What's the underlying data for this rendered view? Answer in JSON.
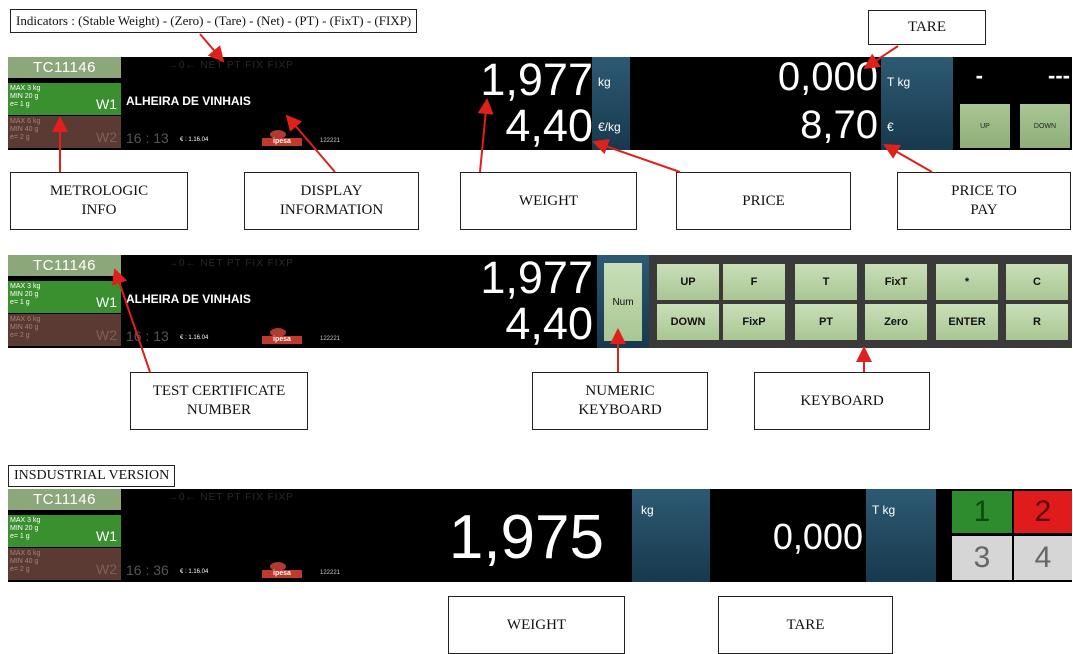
{
  "indicators_box": "Indicators : (Stable Weight) - (Zero) - (Tare) - (Net) - (PT) - (FixT) - (FIXP)",
  "industrial_box": "INSDUSTRIAL VERSION",
  "display": {
    "cert": "TC11146",
    "w1_lines": [
      "MAX  3 kg",
      "MIN  20 g",
      "e=    1 g"
    ],
    "w2_lines": [
      "MAX  6 kg",
      "MIN  40 g",
      "e=    2 g"
    ],
    "w1": "W1",
    "w2": "W2",
    "indicators": "→0←  NET   PT   FIX    FIXP",
    "product": "ALHEIRA DE VINHAIS",
    "euro_small": "€ : 1.16.04",
    "logo_text": "ipesa",
    "code": "122221"
  },
  "panel1": {
    "time": "16 : 13",
    "weight": "1,977",
    "price": "4,40",
    "unit_weight": "kg",
    "unit_price": "€/kg",
    "tare": "0,000",
    "topay": "8,70",
    "unit_tare": "T kg",
    "unit_topay": "€",
    "dash1": "-",
    "dash2": "---",
    "btn_up": "UP",
    "btn_down": "DOWN"
  },
  "panel2": {
    "time": "16 : 13",
    "weight": "1,977",
    "price": "4,40",
    "num": "Num",
    "keys_top": [
      "UP",
      "F",
      "T",
      "FixT",
      "*",
      "C"
    ],
    "keys_bottom": [
      "DOWN",
      "FixP",
      "PT",
      "Zero",
      "ENTER",
      "R"
    ]
  },
  "panel3": {
    "time": "16 : 36",
    "weight": "1,975",
    "unit_weight": "kg",
    "tare": "0,000",
    "unit_tare": "T kg",
    "quad": [
      "1",
      "2",
      "3",
      "4"
    ]
  },
  "callouts": {
    "tare": "TARE",
    "metrologic": "METROLOGIC\nINFO",
    "display_info": "DISPLAY\nINFORMATION",
    "weight": "WEIGHT",
    "price": "PRICE",
    "price_to_pay": "PRICE TO\nPAY",
    "test_cert": "TEST CERTIFICATE\nNUMBER",
    "numeric_kb": "NUMERIC\nKEYBOARD",
    "keyboard": "KEYBOARD",
    "weight2": "WEIGHT",
    "tare2": "TARE"
  },
  "colors": {
    "cert_bg": "#8ca77a",
    "w1_bg": "#3a8f2f",
    "w2_bg": "#5a3a32",
    "unit_bg": "#1f4a63",
    "key_bg": "#b9d3a5",
    "arrow": "#e0201a",
    "quad1": "#2e8b2e",
    "quad2": "#e01b1b",
    "quad34": "#d6d6d6"
  }
}
